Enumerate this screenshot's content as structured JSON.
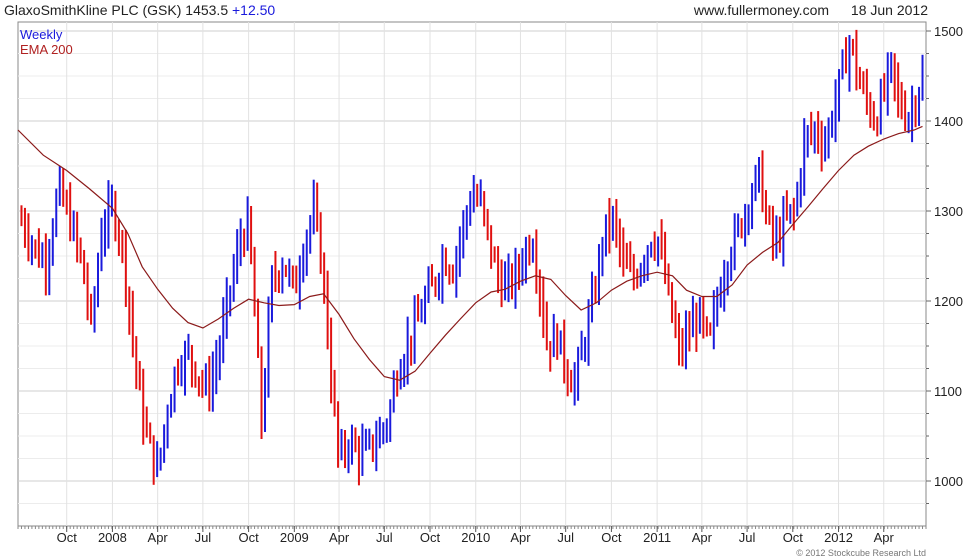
{
  "header": {
    "title": "GlaxoSmithKline PLC (GSK) 1453.5",
    "change": "+12.50",
    "site": "www.fullermoney.com",
    "date": "18 Jun 2012"
  },
  "legend": {
    "period": "Weekly",
    "indicator": "EMA 200"
  },
  "copyright": "© 2012 Stockcube Research Ltd",
  "colors": {
    "up": "#1a1adc",
    "down": "#e01010",
    "ema": "#8b1a1a",
    "grid": "#d8d8d8"
  },
  "chart_data": {
    "type": "line",
    "ylim": [
      950,
      1510
    ],
    "y_ticks": [
      1000,
      1100,
      1200,
      1300,
      1400,
      1500
    ],
    "y_tick_labels": [
      "1000",
      "1100",
      "1200",
      "1300",
      "1400",
      "1500"
    ],
    "x_range": [
      "2007-06-25",
      "2012-06-25"
    ],
    "x_ticks": [
      {
        "label": "Oct",
        "date": "2007-10-01"
      },
      {
        "label": "2008",
        "date": "2008-01-01"
      },
      {
        "label": "Apr",
        "date": "2008-04-01"
      },
      {
        "label": "Jul",
        "date": "2008-07-01"
      },
      {
        "label": "Oct",
        "date": "2008-10-01"
      },
      {
        "label": "2009",
        "date": "2009-01-01"
      },
      {
        "label": "Apr",
        "date": "2009-04-01"
      },
      {
        "label": "Jul",
        "date": "2009-07-01"
      },
      {
        "label": "Oct",
        "date": "2009-10-01"
      },
      {
        "label": "2010",
        "date": "2010-01-01"
      },
      {
        "label": "Apr",
        "date": "2010-04-01"
      },
      {
        "label": "Jul",
        "date": "2010-07-01"
      },
      {
        "label": "Oct",
        "date": "2010-10-01"
      },
      {
        "label": "2011",
        "date": "2011-01-01"
      },
      {
        "label": "Apr",
        "date": "2011-04-01"
      },
      {
        "label": "Jul",
        "date": "2011-07-01"
      },
      {
        "label": "Oct",
        "date": "2011-10-01"
      },
      {
        "label": "2012",
        "date": "2012-01-01"
      },
      {
        "label": "Apr",
        "date": "2012-04-01"
      }
    ],
    "price_series": {
      "name": "Weekly",
      "points": [
        [
          "2007-07-02",
          1290
        ],
        [
          "2007-08-01",
          1255
        ],
        [
          "2007-08-20",
          1245
        ],
        [
          "2007-09-15",
          1325
        ],
        [
          "2007-10-10",
          1285
        ],
        [
          "2007-11-01",
          1240
        ],
        [
          "2007-11-20",
          1170
        ],
        [
          "2007-12-10",
          1280
        ],
        [
          "2008-01-01",
          1305
        ],
        [
          "2008-01-20",
          1265
        ],
        [
          "2008-02-10",
          1160
        ],
        [
          "2008-02-28",
          1080
        ],
        [
          "2008-03-15",
          1040
        ],
        [
          "2008-04-01",
          1010
        ],
        [
          "2008-04-20",
          1080
        ],
        [
          "2008-05-10",
          1130
        ],
        [
          "2008-06-01",
          1140
        ],
        [
          "2008-06-20",
          1120
        ],
        [
          "2008-07-10",
          1100
        ],
        [
          "2008-08-01",
          1140
        ],
        [
          "2008-08-20",
          1200
        ],
        [
          "2008-09-15",
          1270
        ],
        [
          "2008-10-01",
          1285
        ],
        [
          "2008-10-15",
          1170
        ],
        [
          "2008-10-28",
          1060
        ],
        [
          "2008-11-15",
          1220
        ],
        [
          "2008-12-10",
          1245
        ],
        [
          "2009-01-01",
          1210
        ],
        [
          "2009-01-20",
          1265
        ],
        [
          "2009-02-10",
          1300
        ],
        [
          "2009-02-28",
          1230
        ],
        [
          "2009-03-15",
          1120
        ],
        [
          "2009-04-01",
          1020
        ],
        [
          "2009-04-20",
          1045
        ],
        [
          "2009-05-10",
          1030
        ],
        [
          "2009-06-01",
          1035
        ],
        [
          "2009-06-20",
          1050
        ],
        [
          "2009-07-10",
          1070
        ],
        [
          "2009-07-25",
          1120
        ],
        [
          "2009-08-15",
          1150
        ],
        [
          "2009-09-01",
          1170
        ],
        [
          "2009-09-20",
          1200
        ],
        [
          "2009-10-10",
          1220
        ],
        [
          "2009-10-28",
          1250
        ],
        [
          "2009-11-15",
          1235
        ],
        [
          "2009-12-05",
          1280
        ],
        [
          "2009-12-25",
          1320
        ],
        [
          "2010-01-10",
          1310
        ],
        [
          "2010-01-28",
          1265
        ],
        [
          "2010-02-15",
          1225
        ],
        [
          "2010-03-05",
          1215
        ],
        [
          "2010-03-25",
          1230
        ],
        [
          "2010-04-10",
          1255
        ],
        [
          "2010-04-25",
          1270
        ],
        [
          "2010-05-10",
          1215
        ],
        [
          "2010-05-25",
          1150
        ],
        [
          "2010-06-15",
          1160
        ],
        [
          "2010-07-05",
          1120
        ],
        [
          "2010-07-20",
          1110
        ],
        [
          "2010-08-05",
          1150
        ],
        [
          "2010-08-25",
          1200
        ],
        [
          "2010-09-15",
          1275
        ],
        [
          "2010-10-05",
          1290
        ],
        [
          "2010-10-25",
          1240
        ],
        [
          "2010-11-15",
          1225
        ],
        [
          "2010-12-05",
          1250
        ],
        [
          "2010-12-20",
          1270
        ],
        [
          "2011-01-05",
          1265
        ],
        [
          "2011-01-25",
          1200
        ],
        [
          "2011-02-15",
          1140
        ],
        [
          "2011-03-05",
          1165
        ],
        [
          "2011-03-25",
          1185
        ],
        [
          "2011-04-15",
          1150
        ],
        [
          "2011-05-05",
          1210
        ],
        [
          "2011-05-25",
          1255
        ],
        [
          "2011-06-15",
          1280
        ],
        [
          "2011-07-05",
          1315
        ],
        [
          "2011-07-25",
          1340
        ],
        [
          "2011-08-10",
          1290
        ],
        [
          "2011-08-25",
          1260
        ],
        [
          "2011-09-15",
          1290
        ],
        [
          "2011-10-05",
          1300
        ],
        [
          "2011-10-25",
          1380
        ],
        [
          "2011-11-15",
          1390
        ],
        [
          "2011-12-05",
          1375
        ],
        [
          "2011-12-25",
          1420
        ],
        [
          "2012-01-10",
          1460
        ],
        [
          "2012-01-25",
          1490
        ],
        [
          "2012-02-10",
          1445
        ],
        [
          "2012-02-28",
          1420
        ],
        [
          "2012-03-15",
          1400
        ],
        [
          "2012-04-01",
          1430
        ],
        [
          "2012-04-15",
          1460
        ],
        [
          "2012-05-01",
          1420
        ],
        [
          "2012-05-20",
          1405
        ],
        [
          "2012-06-05",
          1425
        ],
        [
          "2012-06-18",
          1453.5
        ]
      ]
    },
    "ema_series": {
      "name": "EMA 200",
      "points": [
        [
          "2007-06-25",
          1390
        ],
        [
          "2007-08-15",
          1362
        ],
        [
          "2007-10-01",
          1345
        ],
        [
          "2007-11-15",
          1325
        ],
        [
          "2008-01-01",
          1303
        ],
        [
          "2008-02-01",
          1275
        ],
        [
          "2008-03-01",
          1238
        ],
        [
          "2008-04-01",
          1213
        ],
        [
          "2008-05-01",
          1192
        ],
        [
          "2008-06-01",
          1176
        ],
        [
          "2008-07-01",
          1170
        ],
        [
          "2008-08-01",
          1180
        ],
        [
          "2008-09-01",
          1192
        ],
        [
          "2008-10-01",
          1202
        ],
        [
          "2008-11-01",
          1198
        ],
        [
          "2008-12-01",
          1195
        ],
        [
          "2009-01-01",
          1196
        ],
        [
          "2009-02-01",
          1205
        ],
        [
          "2009-03-01",
          1208
        ],
        [
          "2009-04-01",
          1185
        ],
        [
          "2009-05-01",
          1158
        ],
        [
          "2009-06-01",
          1135
        ],
        [
          "2009-07-01",
          1116
        ],
        [
          "2009-08-01",
          1112
        ],
        [
          "2009-09-01",
          1122
        ],
        [
          "2009-10-01",
          1142
        ],
        [
          "2009-11-01",
          1162
        ],
        [
          "2009-12-01",
          1180
        ],
        [
          "2010-01-01",
          1198
        ],
        [
          "2010-02-01",
          1210
        ],
        [
          "2010-03-01",
          1213
        ],
        [
          "2010-04-01",
          1222
        ],
        [
          "2010-05-01",
          1228
        ],
        [
          "2010-06-01",
          1224
        ],
        [
          "2010-07-01",
          1206
        ],
        [
          "2010-08-01",
          1190
        ],
        [
          "2010-09-01",
          1198
        ],
        [
          "2010-10-01",
          1212
        ],
        [
          "2010-11-01",
          1222
        ],
        [
          "2010-12-01",
          1228
        ],
        [
          "2011-01-01",
          1232
        ],
        [
          "2011-02-01",
          1228
        ],
        [
          "2011-03-01",
          1212
        ],
        [
          "2011-04-01",
          1205
        ],
        [
          "2011-05-01",
          1205
        ],
        [
          "2011-06-01",
          1218
        ],
        [
          "2011-07-01",
          1240
        ],
        [
          "2011-08-01",
          1254
        ],
        [
          "2011-09-01",
          1265
        ],
        [
          "2011-10-01",
          1285
        ],
        [
          "2011-11-01",
          1305
        ],
        [
          "2011-12-01",
          1325
        ],
        [
          "2012-01-01",
          1345
        ],
        [
          "2012-02-01",
          1362
        ],
        [
          "2012-03-01",
          1372
        ],
        [
          "2012-04-01",
          1380
        ],
        [
          "2012-05-01",
          1386
        ],
        [
          "2012-06-01",
          1390
        ],
        [
          "2012-06-18",
          1394
        ]
      ]
    }
  }
}
